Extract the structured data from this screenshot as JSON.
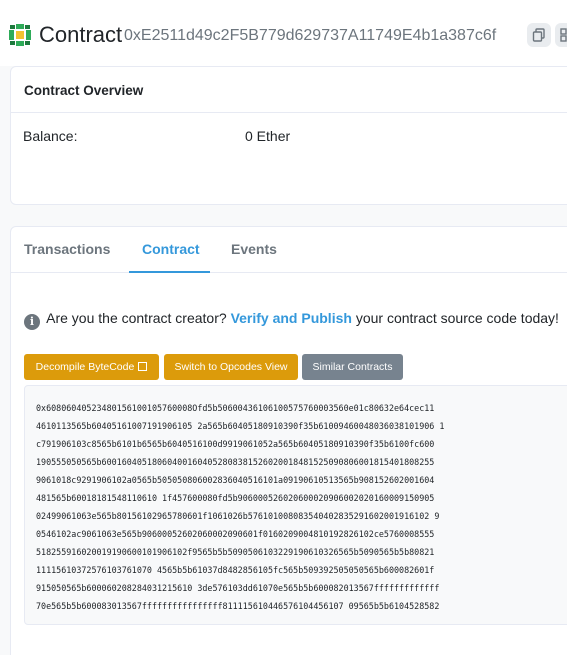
{
  "header": {
    "title": "Contract",
    "address": "0xE2511d49c2F5B779d629737A11749E4b1a387c6f"
  },
  "overview": {
    "title": "Contract Overview",
    "balance_label": "Balance:",
    "balance_value": "0 Ether"
  },
  "tabs": [
    {
      "label": "Transactions",
      "active": false
    },
    {
      "label": "Contract",
      "active": true
    },
    {
      "label": "Events",
      "active": false
    }
  ],
  "notice": {
    "prefix": "Are you the contract creator?",
    "link": "Verify and Publish",
    "suffix": "your contract source code today!"
  },
  "buttons": {
    "decompile": "Decompile ByteCode",
    "opcodes": "Switch to Opcodes View",
    "similar": "Similar Contracts"
  },
  "bytecode_lines": [
    "0x60806040523480156100105760008Ofd5b50600436106100575760003560e01c80632e64cec11",
    "4610113565b60405161007191906105 2a565b60405180910390f35b61009460048036038101906 1",
    "c791906103c8565b6101b6565b6040516100d9919061052a565b60405180910390f35b6100fc600",
    "190555050565b600160405180604001604052808381526020018481525090806001815401808255",
    "9061018c9291906102a0565b505050806002836040516101a09190610513565b908152602001604",
    "481565b60018181548110610 1f457600080fd5b906000526020600020906002020160009150905",
    "02499061063e565b80156102965780601f1061026b576101008083540402835291602001916102 9",
    "0546102ac9061063e565b90600052602060002090601f0160209004810192826102ce5760008555",
    "518255916020019190600101906102f9565b5b5090506103229190610326565b5090565b5b80821",
    "11115610372576103761070 4565b5b61037d8482856105fc565b509392505050565b600082601f",
    "915050565b600060208284031215610 3de576103dd61070e565b5b600082013567fffffffffffff",
    "70e565b5b600083013567ffffffffffffffff811115610446576104456107 09565b5b6104528582"
  ]
}
